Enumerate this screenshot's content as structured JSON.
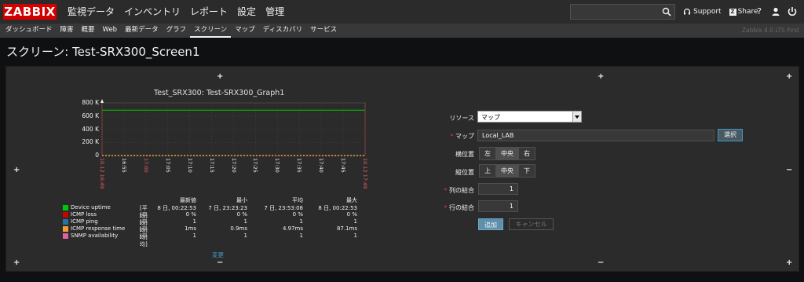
{
  "logo": "ZABBIX",
  "main_menu": [
    "監視データ",
    "インベントリ",
    "レポート",
    "設定",
    "管理"
  ],
  "search": {
    "placeholder": ""
  },
  "top_links": {
    "support": "Support",
    "share": "Share",
    "help": "?"
  },
  "sub_menu": [
    "ダッシュボード",
    "障害",
    "概要",
    "Web",
    "最新データ",
    "グラフ",
    "スクリーン",
    "マップ",
    "ディスカバリ",
    "サービス"
  ],
  "sub_menu_active": "スクリーン",
  "version": "Zabbix 4.0 LTS First",
  "page_title": "スクリーン: Test-SRX300_Screen1",
  "graph": {
    "title": "Test_SRX300: Test-SRX300_Graph1",
    "y_ticks": [
      "800 K",
      "600 K",
      "400 K",
      "200 K",
      "0"
    ],
    "x_ticks": [
      "10.12 16:49",
      "16:55",
      "17:00",
      "17:05",
      "17:10",
      "17:15",
      "17:20",
      "17:25",
      "17:30",
      "17:35",
      "17:40",
      "17:45",
      "10.12 17:49"
    ],
    "x_ticks_red": [
      0,
      2,
      12
    ],
    "legend_headers": [
      "最新値",
      "最小",
      "平均",
      "最大"
    ],
    "legend": [
      {
        "name": "Device uptime",
        "func": "[平均]",
        "color": "#00c800",
        "values": [
          "8 日, 00:22:53",
          "7 日, 23:23:23",
          "7 日, 23:53:08",
          "8 日, 00:22:53"
        ]
      },
      {
        "name": "ICMP loss",
        "func": "[平均]",
        "color": "#c80000",
        "values": [
          "0 %",
          "0 %",
          "0 %",
          "0 %"
        ]
      },
      {
        "name": "ICMP ping",
        "func": "[平均]",
        "color": "#2874a6",
        "values": [
          "1",
          "1",
          "1",
          "1"
        ]
      },
      {
        "name": "ICMP response time",
        "func": "[平均]",
        "color": "#f0a030",
        "values": [
          "1ms",
          "0.9ms",
          "4.97ms",
          "87.1ms"
        ]
      },
      {
        "name": "SNMP availability",
        "func": "[平均]",
        "color": "#e060a0",
        "values": [
          "1",
          "1",
          "1",
          "1"
        ]
      }
    ],
    "change_link": "変更"
  },
  "form": {
    "resource_label": "リソース",
    "resource_value": "マップ",
    "map_label": "マップ",
    "map_value": "Local_LAB",
    "select_button": "選択",
    "halign_label": "横位置",
    "halign_options": [
      "左",
      "中央",
      "右"
    ],
    "halign_selected": 1,
    "valign_label": "縦位置",
    "valign_options": [
      "上",
      "中央",
      "下"
    ],
    "valign_selected": 1,
    "colspan_label": "列の結合",
    "colspan_value": "1",
    "rowspan_label": "行の結合",
    "rowspan_value": "1",
    "add_button": "追加",
    "cancel_button": "キャンセル"
  }
}
